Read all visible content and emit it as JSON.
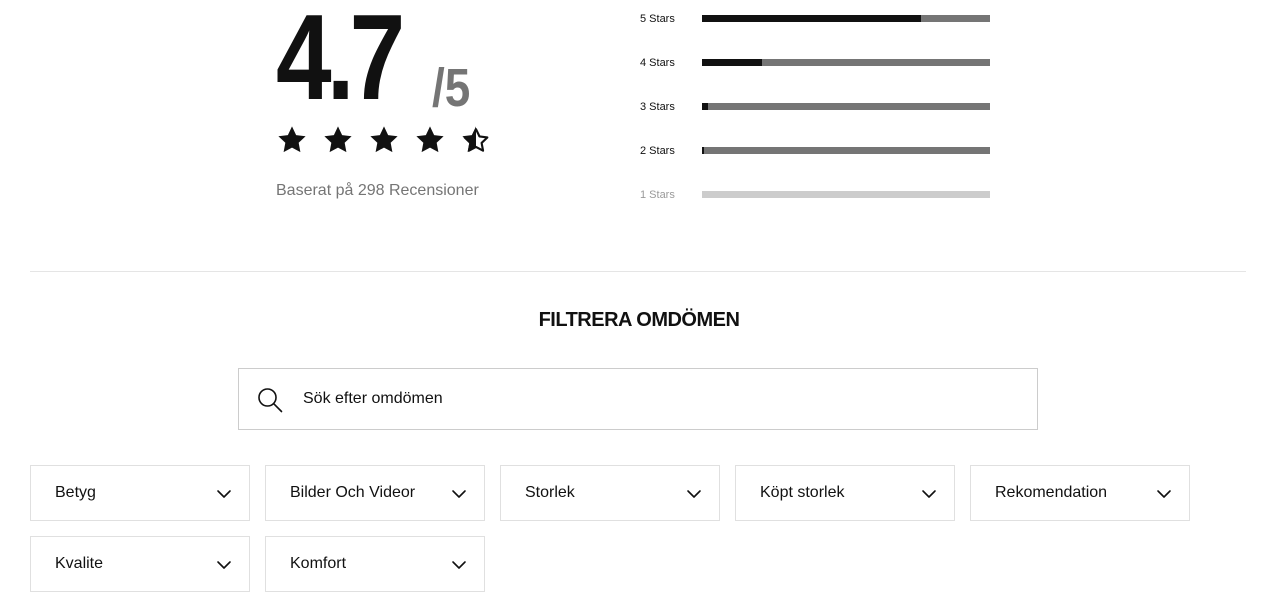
{
  "summary": {
    "score": "4.7",
    "score_max": "/5",
    "rating_value": 4.7,
    "rating_out_of": 5,
    "based_on": "Baserat på 298 Recensioner"
  },
  "histogram": [
    {
      "label": "5 Stars",
      "fraction": 0.76,
      "enabled": true
    },
    {
      "label": "4 Stars",
      "fraction": 0.21,
      "enabled": true
    },
    {
      "label": "3 Stars",
      "fraction": 0.02,
      "enabled": true
    },
    {
      "label": "2 Stars",
      "fraction": 0.005,
      "enabled": true
    },
    {
      "label": "1 Stars",
      "fraction": 0,
      "enabled": false
    }
  ],
  "filter": {
    "title": "Filtrera omdömen",
    "search_placeholder": "Sök efter omdömen",
    "dropdowns": [
      {
        "label": "Betyg"
      },
      {
        "label": "Bilder Och Videor"
      },
      {
        "label": "Storlek"
      },
      {
        "label": "Köpt storlek"
      },
      {
        "label": "Rekomendation"
      },
      {
        "label": "Kvalite"
      },
      {
        "label": "Komfort"
      }
    ]
  },
  "icons": {
    "star": "star-icon",
    "search": "search-icon",
    "chevron": "chevron-down-icon"
  },
  "colors": {
    "primary": "#111111",
    "secondary": "#757575",
    "disabled": "#cccccc",
    "border": "#e0e0e0"
  }
}
